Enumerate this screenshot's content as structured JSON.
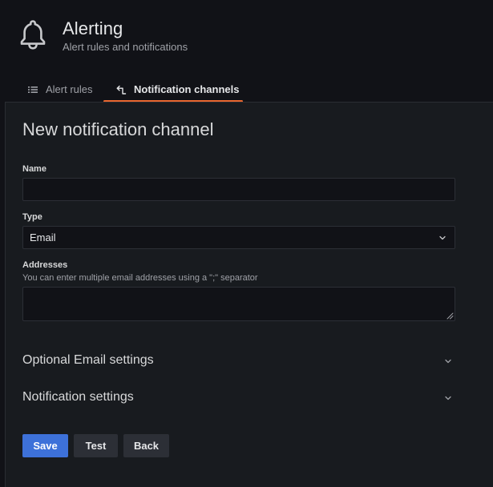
{
  "header": {
    "title": "Alerting",
    "subtitle": "Alert rules and notifications",
    "icon": "bell-icon"
  },
  "tabs": [
    {
      "label": "Alert rules",
      "icon": "list-icon",
      "active": false
    },
    {
      "label": "Notification channels",
      "icon": "notification-channel-icon",
      "active": true
    }
  ],
  "form": {
    "title": "New notification channel",
    "name": {
      "label": "Name",
      "value": ""
    },
    "type": {
      "label": "Type",
      "value": "Email"
    },
    "addresses": {
      "label": "Addresses",
      "description": "You can enter multiple email addresses using a \";\" separator",
      "value": ""
    },
    "sections": [
      {
        "title": "Optional Email settings",
        "expanded": false
      },
      {
        "title": "Notification settings",
        "expanded": false
      }
    ],
    "buttons": {
      "save": "Save",
      "test": "Test",
      "back": "Back"
    }
  },
  "colors": {
    "background": "#111217",
    "panel": "#181b1f",
    "accent_tab": "#e9672f",
    "primary_button": "#3d71d9",
    "secondary_button": "#2c2f36"
  }
}
